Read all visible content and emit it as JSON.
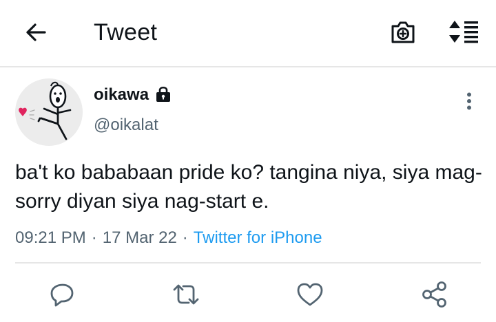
{
  "header": {
    "title": "Tweet",
    "back_icon": "arrow-left-icon",
    "camera_icon": "camera-plus-icon",
    "sort_icon": "sort-list-icon"
  },
  "tweet": {
    "display_name": "oikawa",
    "username": "@oikalat",
    "protected": true,
    "text": "ba't ko bababaan pride ko? tangina niya, siya mag-sorry diyan siya nag-start e.",
    "time": "09:21 PM",
    "date": "17 Mar 22",
    "separator": "·",
    "source": "Twitter for iPhone"
  },
  "actions": {
    "reply_icon": "reply-icon",
    "retweet_icon": "retweet-icon",
    "like_icon": "heart-icon",
    "share_icon": "share-icon"
  },
  "colors": {
    "text": "#0f1419",
    "secondary": "#536471",
    "link": "#1d9bf0",
    "divider": "#e6e6e6",
    "avatar_bg": "#ececec",
    "heart": "#e0245e"
  }
}
